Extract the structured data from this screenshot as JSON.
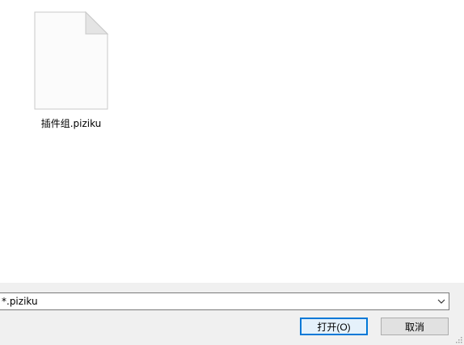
{
  "files": [
    {
      "name": "插件组.piziku",
      "icon": "blank-document-icon"
    }
  ],
  "filter": {
    "selected": "*.piziku",
    "icon": "chevron-down-icon"
  },
  "buttons": {
    "open_label": "打开(O)",
    "cancel_label": "取消"
  },
  "colors": {
    "accent": "#0078d7",
    "bar_background": "#f0f0f0"
  }
}
